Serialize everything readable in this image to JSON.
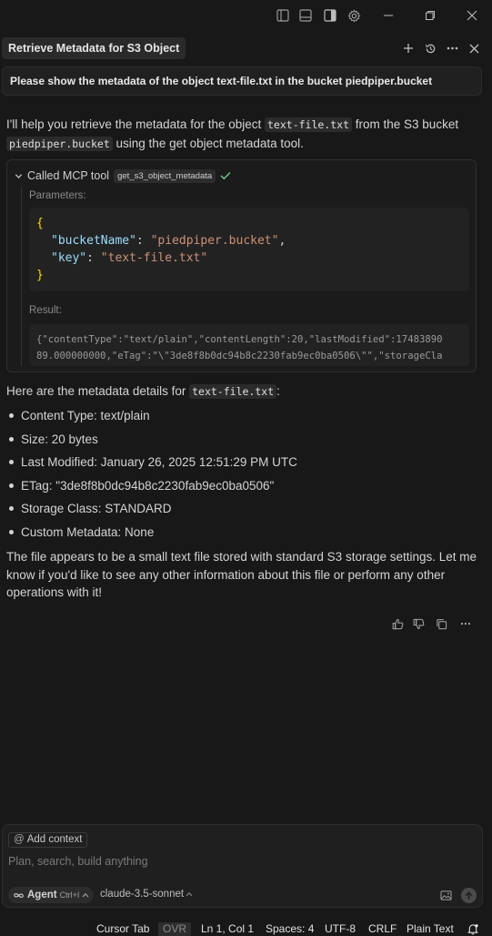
{
  "header": {
    "tab_title": "Retrieve Metadata for S3 Object"
  },
  "user_message": "Please show the metadata of the object text-file.txt in the bucket piedpiper.bucket",
  "assistant": {
    "intro": {
      "part1": "I'll help you retrieve the metadata for the object ",
      "code1": "text-file.txt",
      "part2": " from the S3 bucket ",
      "code2": "piedpiper.bucket",
      "part3": " using the get object metadata tool."
    },
    "tool_call": {
      "label": "Called MCP tool",
      "tool_name": "get_s3_object_metadata",
      "parameters_label": "Parameters:",
      "params": {
        "open": "{",
        "key1": "\"bucketName\"",
        "val1": "\"piedpiper.bucket\"",
        "key2": "\"key\"",
        "val2": "\"text-file.txt\"",
        "close": "}"
      },
      "result_label": "Result:",
      "result_line1": "{\"contentType\":\"text/plain\",\"contentLength\":20,\"lastModified\":17483890",
      "result_line2": "89.000000000,\"eTag\":\"\\\"3de8f8b0dc94b8c2230fab9ec0ba0506\\\"\",\"storageCla"
    },
    "details_intro": "Here are the metadata details for ",
    "details_code": "text-file.txt",
    "details_colon": ":",
    "details": [
      "Content Type: text/plain",
      "Size: 20 bytes",
      "Last Modified: January 26, 2025 12:51:29 PM UTC",
      "ETag: \"3de8f8b0dc94b8c2230fab9ec0ba0506\"",
      "Storage Class: STANDARD",
      "Custom Metadata: None"
    ],
    "closing": "The file appears to be a small text file stored with standard S3 storage settings. Let me know if you'd like to see any other information about this file or perform any other operations with it!"
  },
  "composer": {
    "add_context": "Add context",
    "placeholder": "Plan, search, build anything",
    "agent_label": "Agent",
    "agent_shortcut": "Ctrl+I",
    "model": "claude-3.5-sonnet"
  },
  "statusbar": {
    "cursor_tab": "Cursor Tab",
    "ovr": "OVR",
    "position": "Ln 1, Col 1",
    "spaces": "Spaces: 4",
    "encoding": "UTF-8",
    "eol": "CRLF",
    "language": "Plain Text"
  },
  "colors": {
    "background": "#181818",
    "check": "#73c991",
    "json_key": "#9cdcfe",
    "json_string": "#ce9178",
    "json_brace": "#ffd700"
  }
}
